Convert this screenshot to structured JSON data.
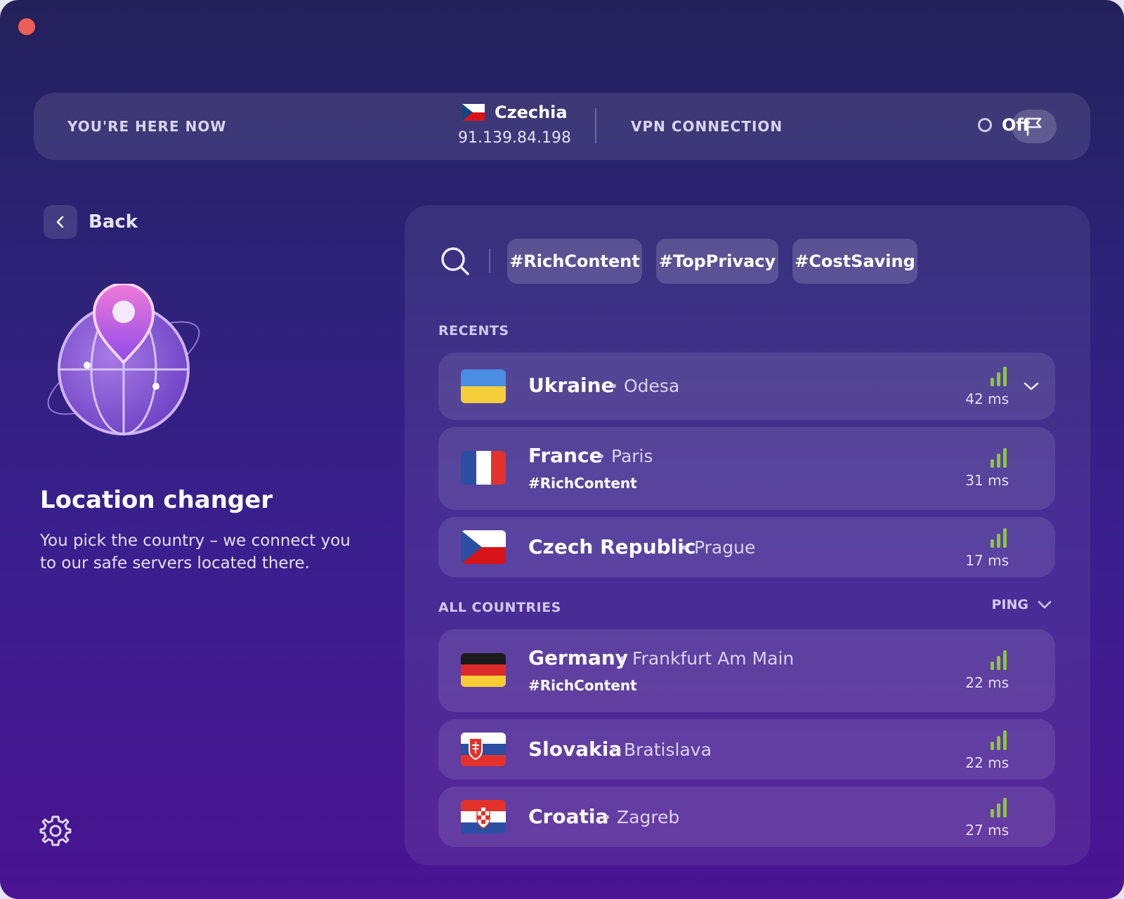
{
  "window": {
    "traffic_light_color": "#ec5f55"
  },
  "status_bar": {
    "location_label": "YOU'RE HERE NOW",
    "country": "Czechia",
    "ip": "91.139.84.198",
    "vpn_label": "VPN CONNECTION",
    "vpn_state": "Off",
    "flag_button_icon": "flag-outline-icon"
  },
  "left": {
    "back_label": "Back",
    "title": "Location changer",
    "description": "You pick the country – we connect you to our safe servers located there."
  },
  "filters": [
    "#RichContent",
    "#TopPrivacy",
    "#CostSaving"
  ],
  "sections": {
    "recents": "RECENTS",
    "all": "ALL COUNTRIES",
    "sort": "PING"
  },
  "recents": [
    {
      "country": "Ukraine",
      "city": "Odesa",
      "tag": "",
      "ping": "42 ms",
      "flag": "ukraine"
    },
    {
      "country": "France",
      "city": "Paris",
      "tag": "#RichContent",
      "ping": "31 ms",
      "flag": "france"
    },
    {
      "country": "Czech Republic",
      "city": "Prague",
      "tag": "",
      "ping": "17 ms",
      "flag": "czech"
    }
  ],
  "all_countries": [
    {
      "country": "Germany",
      "city": "Frankfurt Am Main",
      "tag": "#RichContent",
      "ping": "22 ms",
      "flag": "germany"
    },
    {
      "country": "Slovakia",
      "city": "Bratislava",
      "tag": "",
      "ping": "22 ms",
      "flag": "slovakia"
    },
    {
      "country": "Croatia",
      "city": "Zagreb",
      "tag": "",
      "ping": "27 ms",
      "flag": "croatia"
    }
  ],
  "colors": {
    "signal": "#8cc63f",
    "accent": "#c27bf0"
  }
}
